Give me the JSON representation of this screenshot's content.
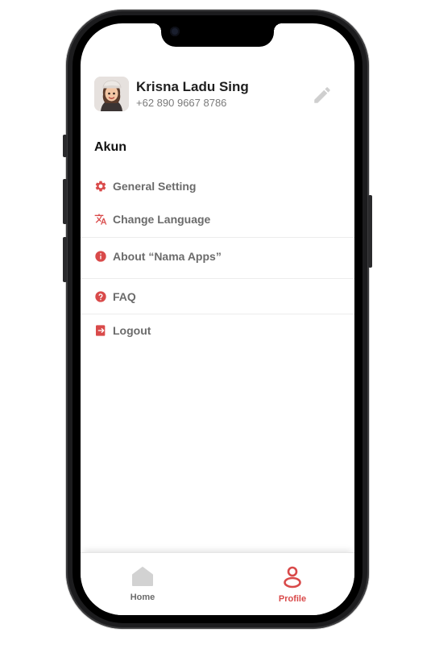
{
  "colors": {
    "accent": "#d94a4a",
    "text_primary": "#1e1e1e",
    "text_muted": "#6b6b6b",
    "edit_icon": "#cfcfcf"
  },
  "profile": {
    "name": "Krisna Ladu Sing",
    "phone": "+62 890 9667 8786"
  },
  "section": {
    "title": "Akun"
  },
  "menu": {
    "general_setting": "General Setting",
    "change_language": "Change Language",
    "about": "About “Nama Apps”",
    "faq": "FAQ",
    "logout": "Logout"
  },
  "nav": {
    "home": "Home",
    "profile": "Profile",
    "active": "profile"
  },
  "icons": {
    "edit": "pencil-icon",
    "general_setting": "gear-icon",
    "change_language": "translate-icon",
    "about": "info-icon",
    "faq": "question-icon",
    "logout": "logout-icon",
    "home": "home-icon",
    "profile": "person-icon"
  }
}
